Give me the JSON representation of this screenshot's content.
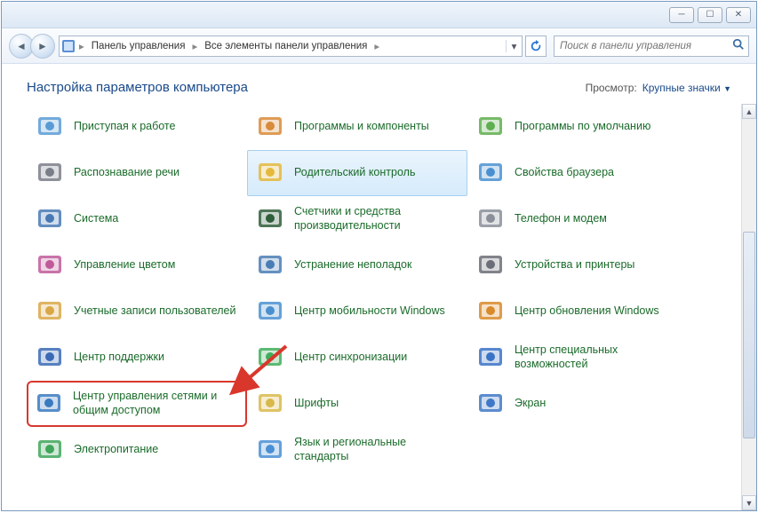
{
  "breadcrumb": {
    "item1": "Панель управления",
    "item2": "Все элементы панели управления"
  },
  "search": {
    "placeholder": "Поиск в панели управления"
  },
  "page_title": "Настройка параметров компьютера",
  "view": {
    "label": "Просмотр:",
    "value": "Крупные значки"
  },
  "items": [
    {
      "label": "Приступая к работе",
      "icon": "getting-started"
    },
    {
      "label": "Программы и компоненты",
      "icon": "programs"
    },
    {
      "label": "Программы по умолчанию",
      "icon": "defaults"
    },
    {
      "label": "Распознавание речи",
      "icon": "speech"
    },
    {
      "label": "Родительский контроль",
      "icon": "parental",
      "selected": true
    },
    {
      "label": "Свойства браузера",
      "icon": "internet"
    },
    {
      "label": "Система",
      "icon": "system"
    },
    {
      "label": "Счетчики и средства производительности",
      "icon": "perf"
    },
    {
      "label": "Телефон и модем",
      "icon": "phone"
    },
    {
      "label": "Управление цветом",
      "icon": "color"
    },
    {
      "label": "Устранение неполадок",
      "icon": "troubleshoot"
    },
    {
      "label": "Устройства и принтеры",
      "icon": "devices"
    },
    {
      "label": "Учетные записи пользователей",
      "icon": "users"
    },
    {
      "label": "Центр мобильности Windows",
      "icon": "mobility"
    },
    {
      "label": "Центр обновления Windows",
      "icon": "update"
    },
    {
      "label": "Центр поддержки",
      "icon": "action"
    },
    {
      "label": "Центр синхронизации",
      "icon": "sync"
    },
    {
      "label": "Центр специальных возможностей",
      "icon": "ease"
    },
    {
      "label": "Центр управления сетями и общим доступом",
      "icon": "network",
      "highlighted": true
    },
    {
      "label": "Шрифты",
      "icon": "fonts"
    },
    {
      "label": "Экран",
      "icon": "display"
    },
    {
      "label": "Электропитание",
      "icon": "power"
    },
    {
      "label": "Язык и региональные стандарты",
      "icon": "region"
    }
  ]
}
